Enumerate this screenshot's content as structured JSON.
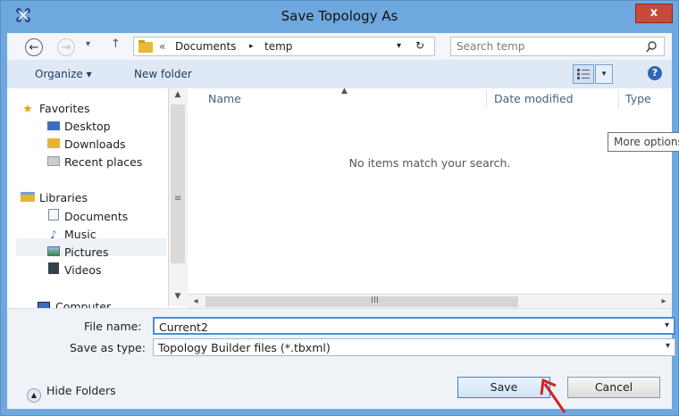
{
  "window": {
    "title": "Save Topology As",
    "close_label": "x"
  },
  "nav": {
    "back_glyph": "←",
    "forward_glyph": "→",
    "recent_glyph": "▾",
    "up_glyph": "↑",
    "refresh_glyph": "↻",
    "breadcrumb": [
      "Documents",
      "temp"
    ],
    "breadcrumb_prefix": "«",
    "breadcrumb_sep": "▸",
    "search_placeholder": "Search temp"
  },
  "toolbar": {
    "organize_label": "Organize ▾",
    "new_folder_label": "New folder",
    "view_dropdown_glyph": "▾",
    "help_glyph": "?"
  },
  "navpane": {
    "favorites_label": "Favorites",
    "favorites": [
      {
        "label": "Desktop",
        "icon": "desktop-icon"
      },
      {
        "label": "Downloads",
        "icon": "downloads-icon"
      },
      {
        "label": "Recent places",
        "icon": "recent-places-icon"
      }
    ],
    "libraries_label": "Libraries",
    "libraries": [
      {
        "label": "Documents",
        "icon": "documents-icon",
        "selected": true
      },
      {
        "label": "Music",
        "icon": "music-icon"
      },
      {
        "label": "Pictures",
        "icon": "pictures-icon"
      },
      {
        "label": "Videos",
        "icon": "videos-icon"
      }
    ],
    "computer_label": "Computer"
  },
  "filelist": {
    "columns": [
      "Name",
      "Date modified",
      "Type"
    ],
    "empty_message": "No items match your search.",
    "tooltip": "More options"
  },
  "form": {
    "filename_label": "File name:",
    "filename_value": "Current2",
    "savetype_label": "Save as type:",
    "savetype_value": "Topology Builder files (*.tbxml)"
  },
  "footer": {
    "hide_folders_label": "Hide Folders",
    "save_label": "Save",
    "cancel_label": "Cancel"
  },
  "colors": {
    "titlebar": "#6fa8de",
    "close_button": "#c7493a",
    "toolbar": "#dfe9f6",
    "pointer_arrow": "#d0241c"
  }
}
